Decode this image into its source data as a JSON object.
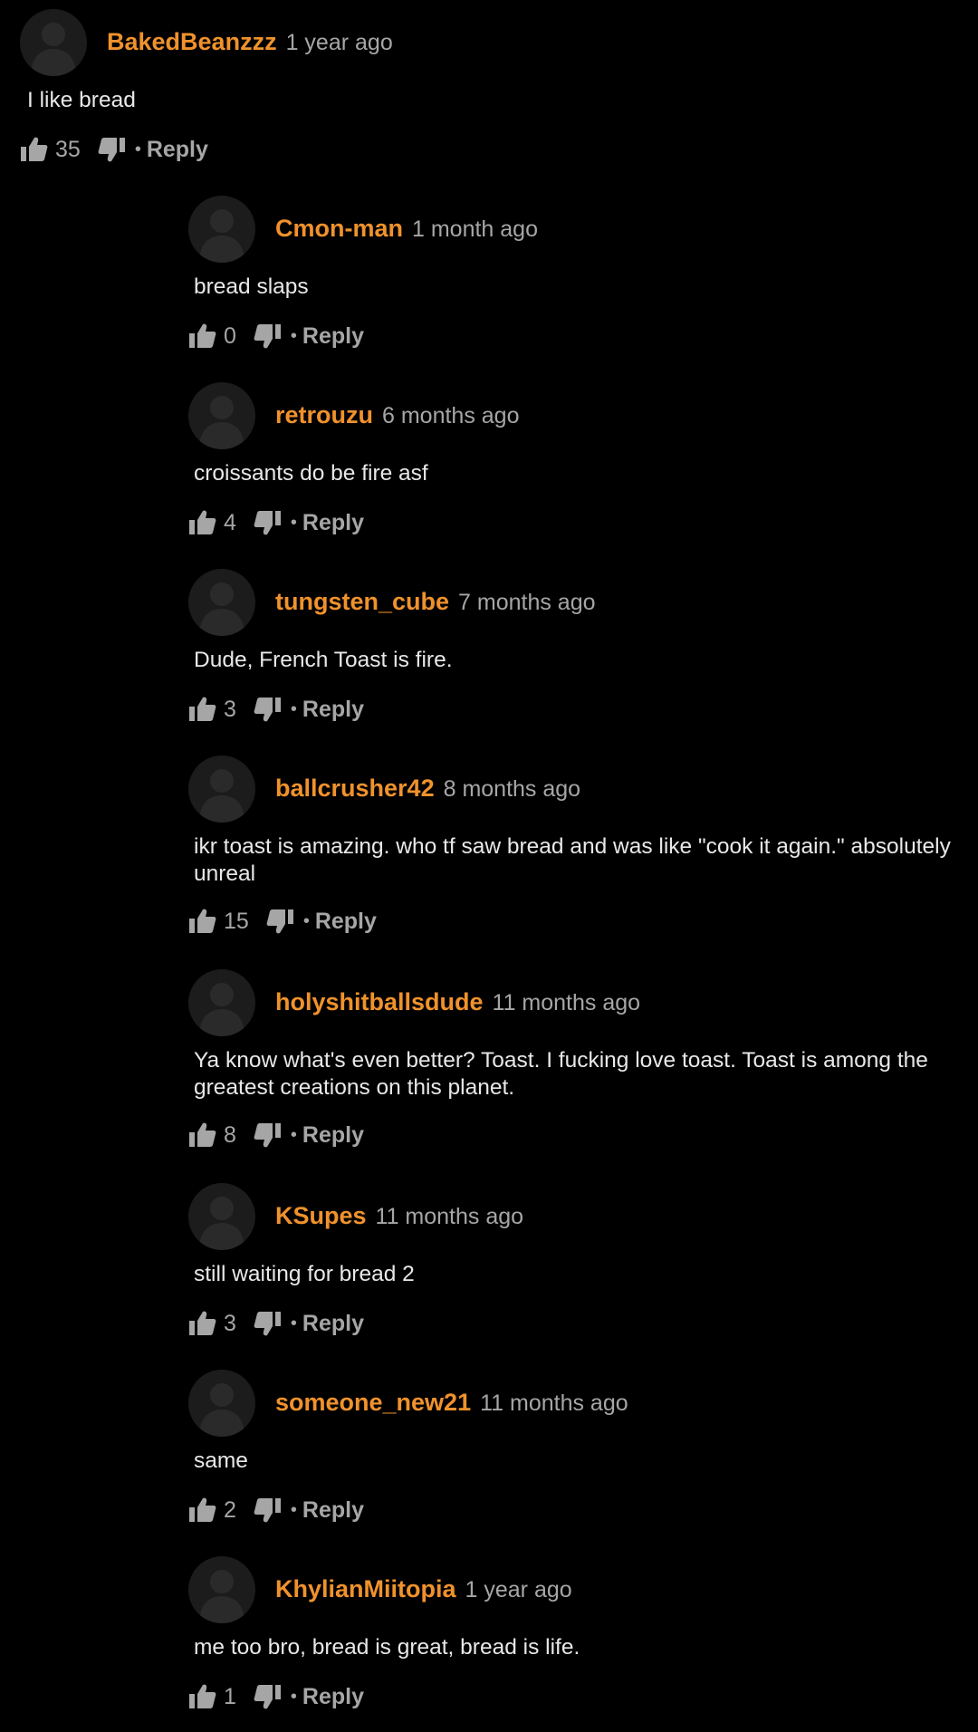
{
  "colors": {
    "background": "#000000",
    "username": "#f0922c",
    "meta": "#a6a6a6",
    "text": "#e8e8e8"
  },
  "icons": {
    "avatar": "default-avatar-icon",
    "like": "thumbs-up-icon",
    "dislike": "thumbs-down-icon"
  },
  "reply_label": "Reply",
  "separator": "•",
  "parent": {
    "username": "BakedBeanzzz",
    "time": "1 year ago",
    "text": "I like bread",
    "likes": "35"
  },
  "replies": [
    {
      "username": "Cmon-man",
      "time": "1 month ago",
      "text": "bread slaps",
      "likes": "0"
    },
    {
      "username": "retrouzu",
      "time": "6 months ago",
      "text": "croissants do be fire asf",
      "likes": "4"
    },
    {
      "username": "tungsten_cube",
      "time": "7 months ago",
      "text": "Dude, French Toast is fire.",
      "likes": "3"
    },
    {
      "username": "ballcrusher42",
      "time": "8 months ago",
      "text": "ikr toast is amazing. who tf saw bread and was like \"cook it again.\" absolutely unreal",
      "likes": "15"
    },
    {
      "username": "holyshitballsdude",
      "time": "11 months ago",
      "text": "Ya know what's even better? Toast. I fucking love toast. Toast is among the greatest creations on this planet.",
      "likes": "8"
    },
    {
      "username": "KSupes",
      "time": "11 months ago",
      "text": "still waiting for bread 2",
      "likes": "3"
    },
    {
      "username": "someone_new21",
      "time": "11 months ago",
      "text": "same",
      "likes": "2"
    },
    {
      "username": "KhylianMiitopia",
      "time": "1 year ago",
      "text": "me too bro, bread is great, bread is life.",
      "likes": "1"
    }
  ]
}
